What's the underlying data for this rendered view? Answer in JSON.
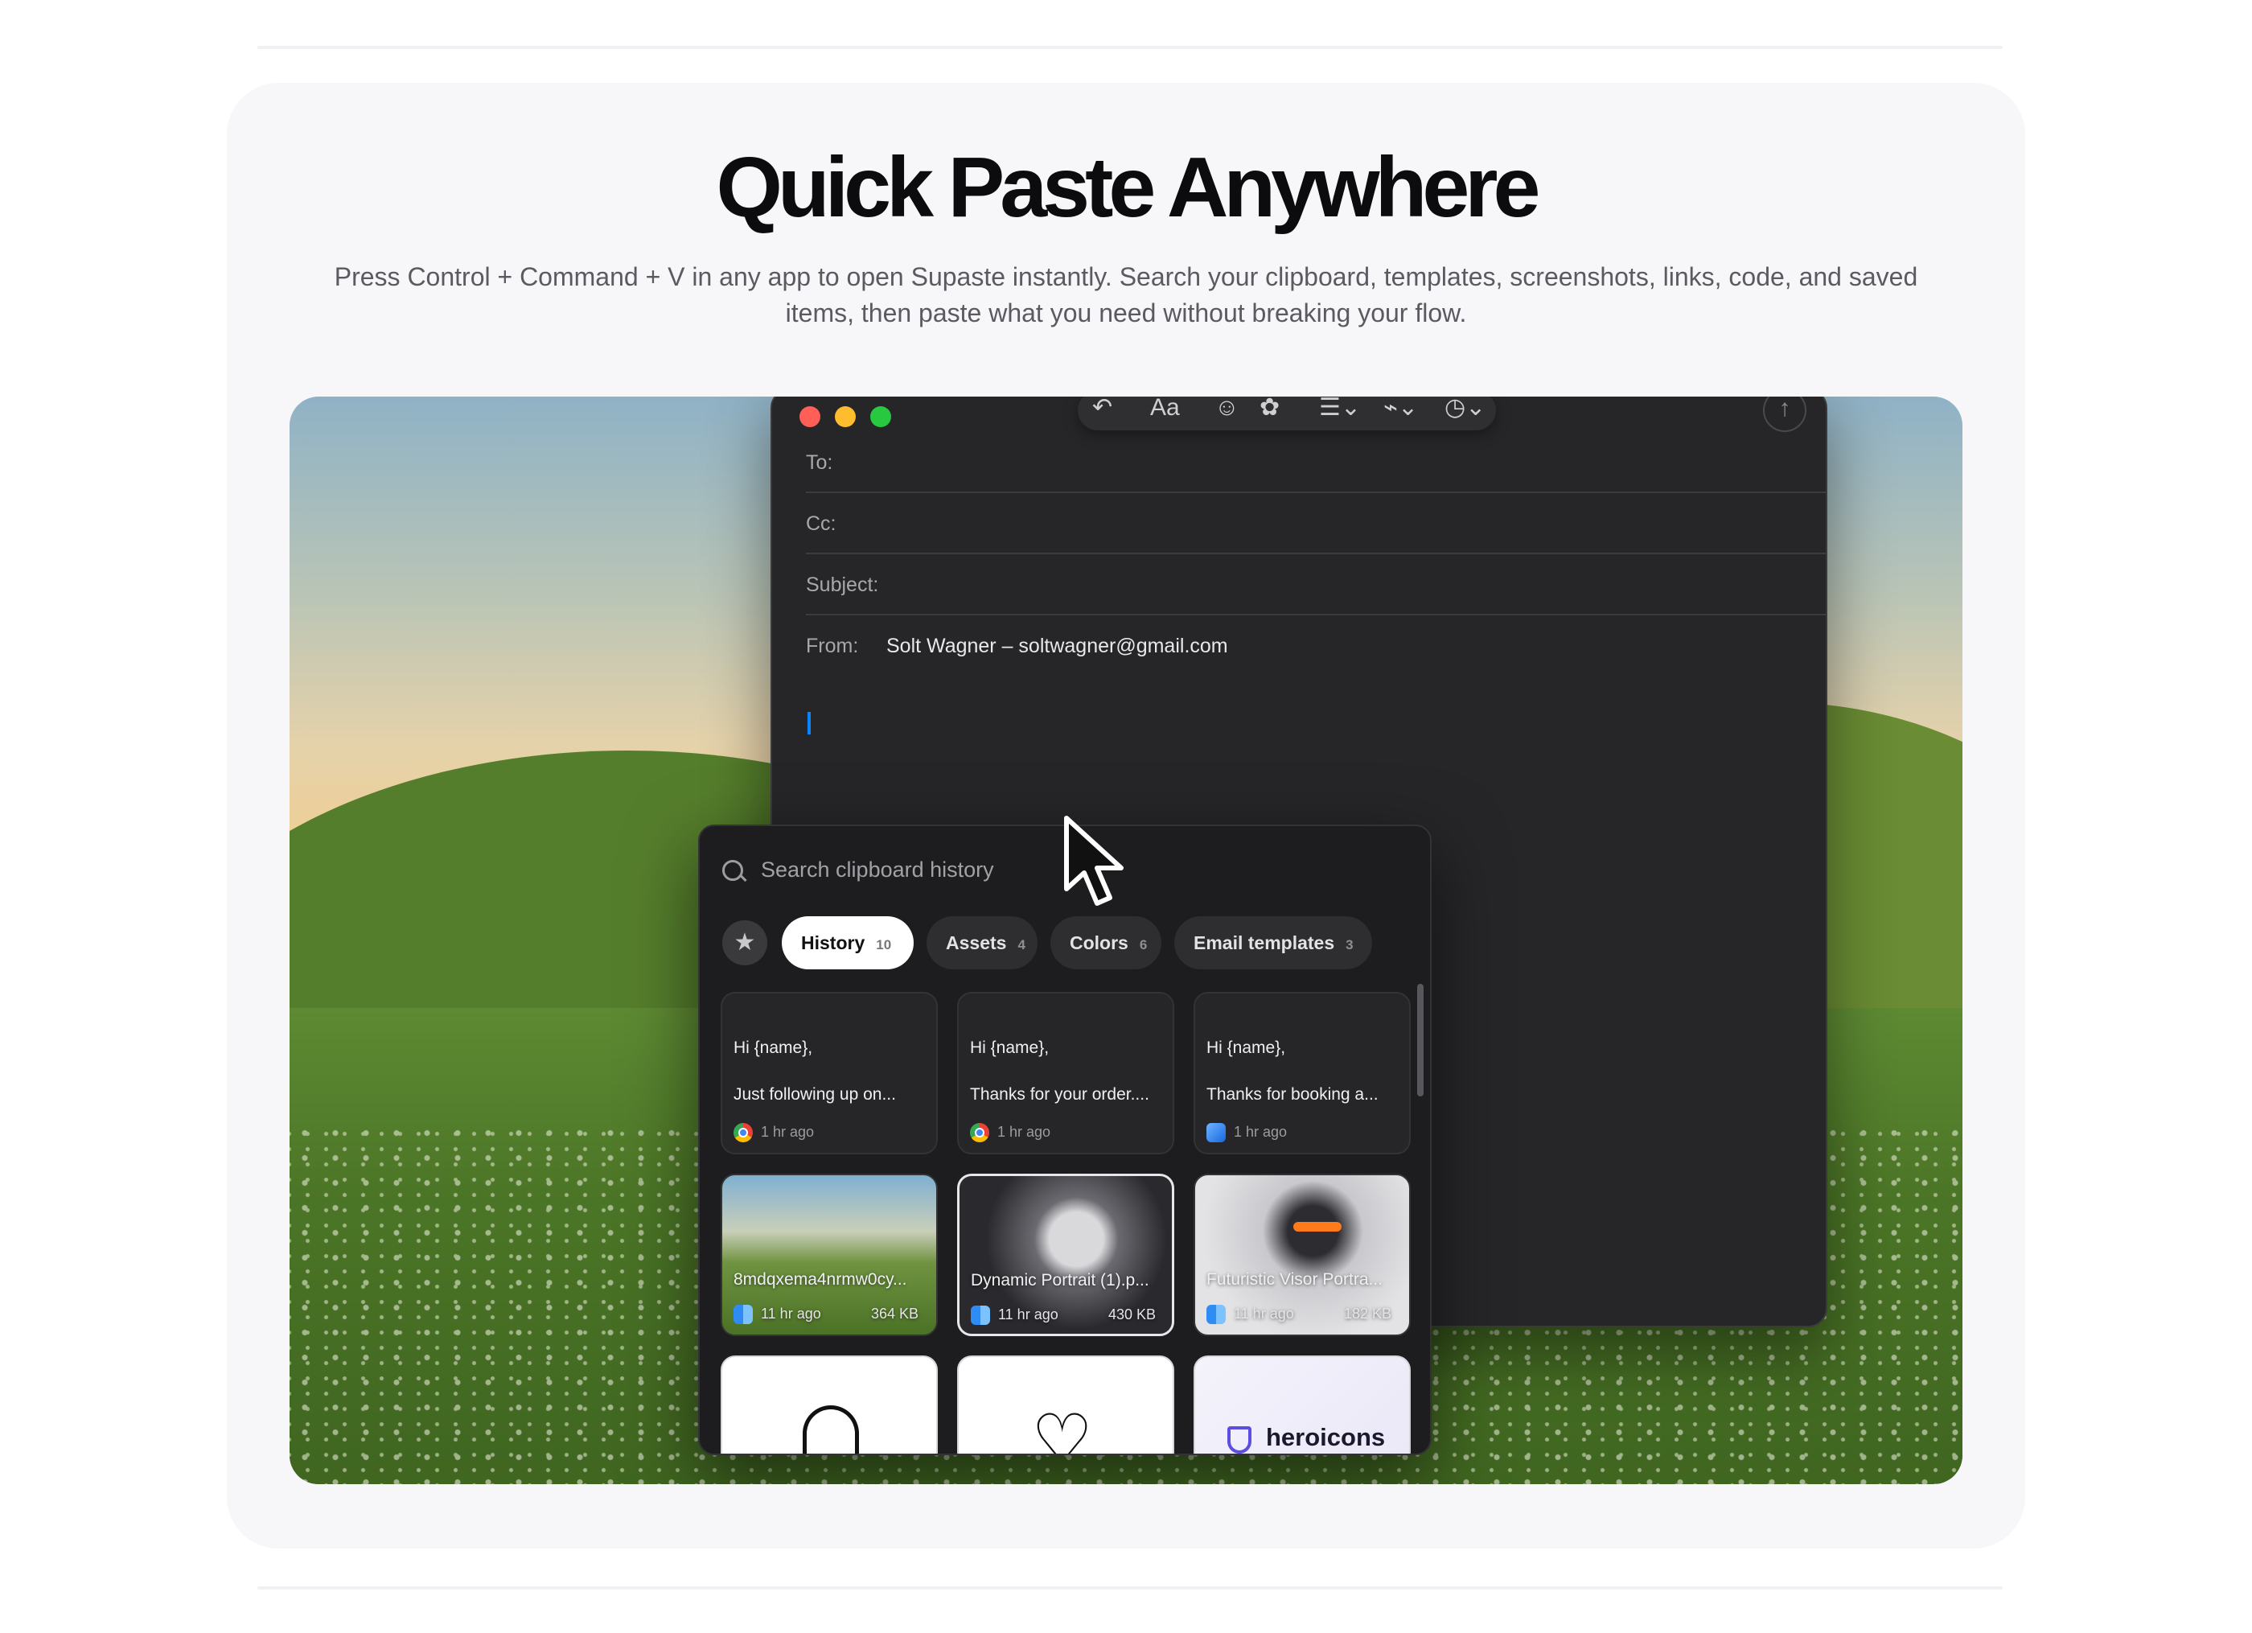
{
  "section": {
    "title": "Quick Paste Anywhere",
    "subtitle": "Press Control + Command + V in any app to open Supaste instantly. Search your clipboard, templates, screenshots, links, code, and saved items, then paste what you need without breaking your flow."
  },
  "mail": {
    "toolbar": {
      "font_label": "Aa"
    },
    "fields": [
      {
        "label": "To:",
        "value": ""
      },
      {
        "label": "Cc:",
        "value": ""
      },
      {
        "label": "Subject:",
        "value": ""
      },
      {
        "label": "From:",
        "value": "Solt Wagner – soltwagner@gmail.com"
      }
    ]
  },
  "clipboard": {
    "search": {
      "placeholder": "Search clipboard history"
    },
    "tabs": [
      {
        "label": "History",
        "count": "10",
        "active": true
      },
      {
        "label": "Assets",
        "count": "4"
      },
      {
        "label": "Colors",
        "count": "6"
      },
      {
        "label": "Email templates",
        "count": "3"
      }
    ],
    "text_items": [
      {
        "line1": "Hi {name},",
        "line2": "Just following up on...",
        "time": "1 hr ago",
        "app_icon": "chrome-icon"
      },
      {
        "line1": "Hi {name},",
        "line2": "Thanks for your order....",
        "time": "1 hr ago",
        "app_icon": "chrome-icon"
      },
      {
        "line1": "Hi {name},",
        "line2": "Thanks for booking a...",
        "time": "1 hr ago",
        "app_icon": "mail-app-icon"
      }
    ],
    "image_items": [
      {
        "name": "8mdqxema4nrmw0cy...",
        "time": "11 hr ago",
        "size": "364 KB",
        "app_icon": "finder-icon"
      },
      {
        "name": "Dynamic Portrait (1).p...",
        "time": "11 hr ago",
        "size": "430 KB",
        "app_icon": "finder-icon"
      },
      {
        "name": "Futuristic Visor Portra...",
        "time": "11 hr ago",
        "size": "182 KB",
        "app_icon": "finder-icon"
      }
    ],
    "asset_items": [
      {
        "icon": "bell-icon"
      },
      {
        "icon": "heart-icon"
      },
      {
        "brand": "heroicons"
      }
    ]
  },
  "colors": {
    "accent": "#0a84ff",
    "active_tab": "#ffffff",
    "panel": "#1d1d20"
  }
}
